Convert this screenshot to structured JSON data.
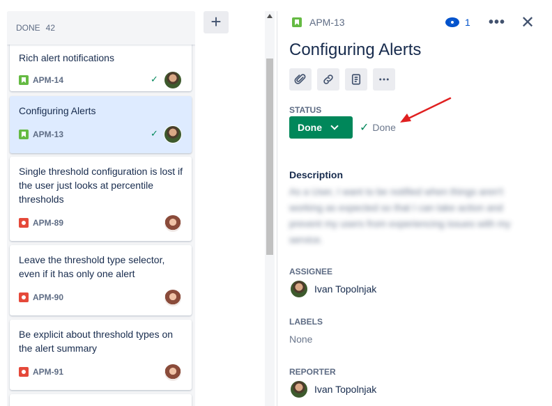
{
  "column": {
    "title": "DONE",
    "count": "42"
  },
  "add_column_symbol": "+",
  "cards": [
    {
      "title": "Rich alert notifications",
      "key": "APM-14",
      "type": "story",
      "done": true,
      "assignee": "male",
      "selected": false
    },
    {
      "title": "Configuring Alerts",
      "key": "APM-13",
      "type": "story",
      "done": true,
      "assignee": "male",
      "selected": true
    },
    {
      "title": "Single threshold configuration is lost if the user just looks at percentile thresholds",
      "key": "APM-89",
      "type": "bug",
      "done": false,
      "assignee": "female",
      "selected": false
    },
    {
      "title": "Leave the threshold type selector, even if it has only one alert",
      "key": "APM-90",
      "type": "bug",
      "done": false,
      "assignee": "female",
      "selected": false
    },
    {
      "title": "Be explicit about threshold types on the alert summary",
      "key": "APM-91",
      "type": "bug",
      "done": false,
      "assignee": "female",
      "selected": false
    }
  ],
  "detail": {
    "key": "APM-13",
    "watch_count": "1",
    "more_symbol": "•••",
    "close_symbol": "✕",
    "title": "Configuring Alerts",
    "toolbar": [
      "paperclip-icon",
      "link-icon",
      "page-icon",
      "more-icon"
    ],
    "status_label": "STATUS",
    "status_value": "Done",
    "resolution": "Done",
    "check_symbol": "✓",
    "description_label": "Description",
    "description_text": "As a User, I want to be notified when things aren't working as expected so that I can take action and prevent my users from experiencing issues with my service.",
    "assignee_label": "ASSIGNEE",
    "assignee_name": "Ivan Topolnjak",
    "labels_label": "LABELS",
    "labels_value": "None",
    "reporter_label": "REPORTER",
    "reporter_name": "Ivan Topolnjak"
  },
  "colors": {
    "done_green": "#00875a",
    "accent_blue": "#0052cc",
    "selected_card": "#deebff",
    "annotation_arrow": "#e02020"
  }
}
